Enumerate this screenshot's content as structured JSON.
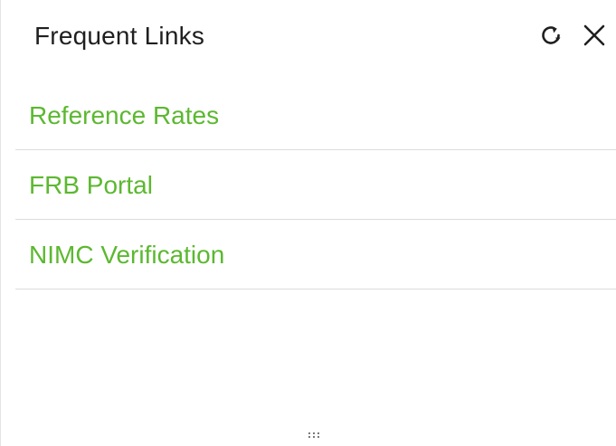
{
  "panel": {
    "title": "Frequent Links"
  },
  "actions": {
    "refresh_icon": "refresh-icon",
    "close_icon": "close-icon"
  },
  "links": [
    {
      "label": "Reference Rates"
    },
    {
      "label": "FRB Portal"
    },
    {
      "label": "NIMC Verification"
    }
  ],
  "colors": {
    "link": "#5cb830",
    "title": "#1f1f1f",
    "divider": "#dcdcdc"
  }
}
